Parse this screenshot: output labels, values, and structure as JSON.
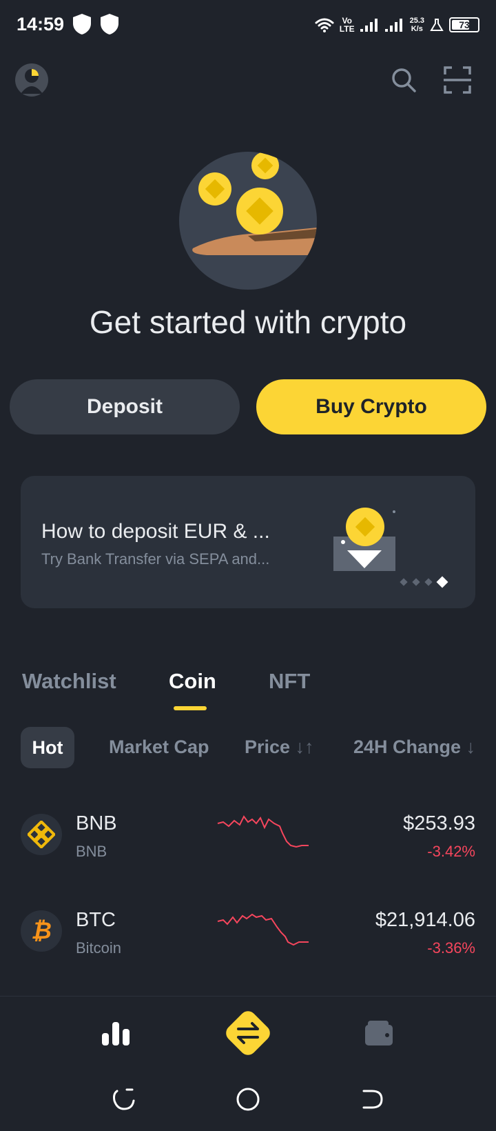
{
  "status_bar": {
    "time": "14:59",
    "network_label_top": "Vo",
    "network_label_bottom": "LTE",
    "speed_value": "25.3",
    "speed_unit": "K/s",
    "battery_level": 73,
    "battery_text": "73"
  },
  "header": {
    "avatar_icon": "avatar-icon",
    "search_icon": "search-icon",
    "scan_icon": "scan-icon"
  },
  "hero": {
    "title": "Get started with crypto"
  },
  "actions": {
    "deposit_label": "Deposit",
    "buy_label": "Buy Crypto"
  },
  "banner": {
    "title": "How to deposit EUR & ...",
    "subtitle": "Try Bank Transfer via SEPA and...",
    "page_count": 4,
    "active_page": 4
  },
  "tabs": [
    {
      "label": "Watchlist",
      "active": false
    },
    {
      "label": "Coin",
      "active": true
    },
    {
      "label": "NFT",
      "active": false
    }
  ],
  "filters": {
    "hot": "Hot",
    "market_cap": "Market Cap",
    "price": "Price",
    "price_sort": "↓↑",
    "change": "24H Change",
    "change_sort": "↓"
  },
  "coins": [
    {
      "symbol": "BNB",
      "name": "BNB",
      "price": "$253.93",
      "change": "-3.42%",
      "icon": "bnb-icon"
    },
    {
      "symbol": "BTC",
      "name": "Bitcoin",
      "price": "$21,914.06",
      "change": "-3.36%",
      "icon": "btc-icon"
    }
  ],
  "colors": {
    "background": "#1f232b",
    "accent": "#fcd535",
    "negative": "#f6465d",
    "muted": "#848e9c"
  }
}
